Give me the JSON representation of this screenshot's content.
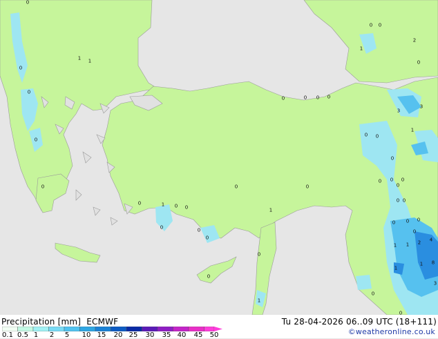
{
  "footer": {
    "legend_title": "Precipitation [mm]",
    "model": "ECMWF",
    "valid_time": "Tu 28-04-2026 06..09 UTC (18+111)",
    "credit": "©weatheronline.co.uk"
  },
  "legend": {
    "labels": [
      "0.1",
      "0.5",
      "1",
      "2",
      "5",
      "10",
      "15",
      "20",
      "25",
      "30",
      "35",
      "40",
      "45",
      "50"
    ],
    "colors": [
      "#f2fef4",
      "#c3f9e4",
      "#a0f1f4",
      "#79dbf5",
      "#51c3f0",
      "#2fa6e3",
      "#1a82d6",
      "#0d5cc4",
      "#0a2ba5",
      "#5b1ab7",
      "#8f1ec4",
      "#c424c8",
      "#e92fc7",
      "#ff3ddb"
    ]
  },
  "map": {
    "colors": {
      "sea": "#e6e6e6",
      "land_dry": "#e1e1e1",
      "land_precip": "#c6f59b",
      "rain_light": "#9ee6f2",
      "rain_medium": "#56c1ef",
      "rain_heavy": "#2a8ee0",
      "coast": "#9a9a9a"
    },
    "station_values": [
      {
        "id": "s1",
        "value": "0"
      },
      {
        "id": "s2",
        "value": "1"
      },
      {
        "id": "s3",
        "value": "1"
      },
      {
        "id": "s4",
        "value": "0"
      },
      {
        "id": "s5",
        "value": "0"
      },
      {
        "id": "s6",
        "value": "0"
      },
      {
        "id": "s7",
        "value": "0"
      },
      {
        "id": "s8",
        "value": "0"
      },
      {
        "id": "s9",
        "value": "1"
      },
      {
        "id": "s10",
        "value": "0"
      },
      {
        "id": "s11",
        "value": "0"
      },
      {
        "id": "s12",
        "value": "0"
      },
      {
        "id": "s13",
        "value": "0"
      },
      {
        "id": "s14",
        "value": "0"
      },
      {
        "id": "s15",
        "value": "0"
      },
      {
        "id": "s16",
        "value": "0"
      },
      {
        "id": "s17",
        "value": "1"
      },
      {
        "id": "s18",
        "value": "3"
      },
      {
        "id": "s19",
        "value": "3"
      },
      {
        "id": "s20",
        "value": "1"
      },
      {
        "id": "s21",
        "value": "0"
      },
      {
        "id": "s22",
        "value": "0"
      },
      {
        "id": "s23",
        "value": "2"
      },
      {
        "id": "s24",
        "value": "1"
      },
      {
        "id": "s25",
        "value": "0"
      },
      {
        "id": "s26",
        "value": "0"
      },
      {
        "id": "s27",
        "value": "0"
      },
      {
        "id": "s28",
        "value": "0"
      },
      {
        "id": "s29",
        "value": "0"
      },
      {
        "id": "s30",
        "value": "0"
      },
      {
        "id": "s31",
        "value": "0"
      },
      {
        "id": "s32",
        "value": "0"
      },
      {
        "id": "s33",
        "value": "0"
      },
      {
        "id": "s34",
        "value": "0"
      },
      {
        "id": "s35",
        "value": "0"
      },
      {
        "id": "s36",
        "value": "0"
      },
      {
        "id": "s37",
        "value": "0"
      },
      {
        "id": "s38",
        "value": "0"
      },
      {
        "id": "s39",
        "value": "0"
      },
      {
        "id": "s40",
        "value": "0"
      },
      {
        "id": "s41",
        "value": "0"
      },
      {
        "id": "s42",
        "value": "0"
      },
      {
        "id": "s43",
        "value": "0"
      },
      {
        "id": "s44",
        "value": "2"
      },
      {
        "id": "s45",
        "value": "1"
      },
      {
        "id": "s46",
        "value": "1"
      },
      {
        "id": "s47",
        "value": "4"
      },
      {
        "id": "s48",
        "value": "1"
      },
      {
        "id": "s49",
        "value": "1"
      },
      {
        "id": "s50",
        "value": "8"
      },
      {
        "id": "s51",
        "value": "0"
      },
      {
        "id": "s52",
        "value": "3"
      },
      {
        "id": "s53",
        "value": "0"
      },
      {
        "id": "s54",
        "value": "1"
      },
      {
        "id": "s55",
        "value": "0"
      }
    ]
  }
}
